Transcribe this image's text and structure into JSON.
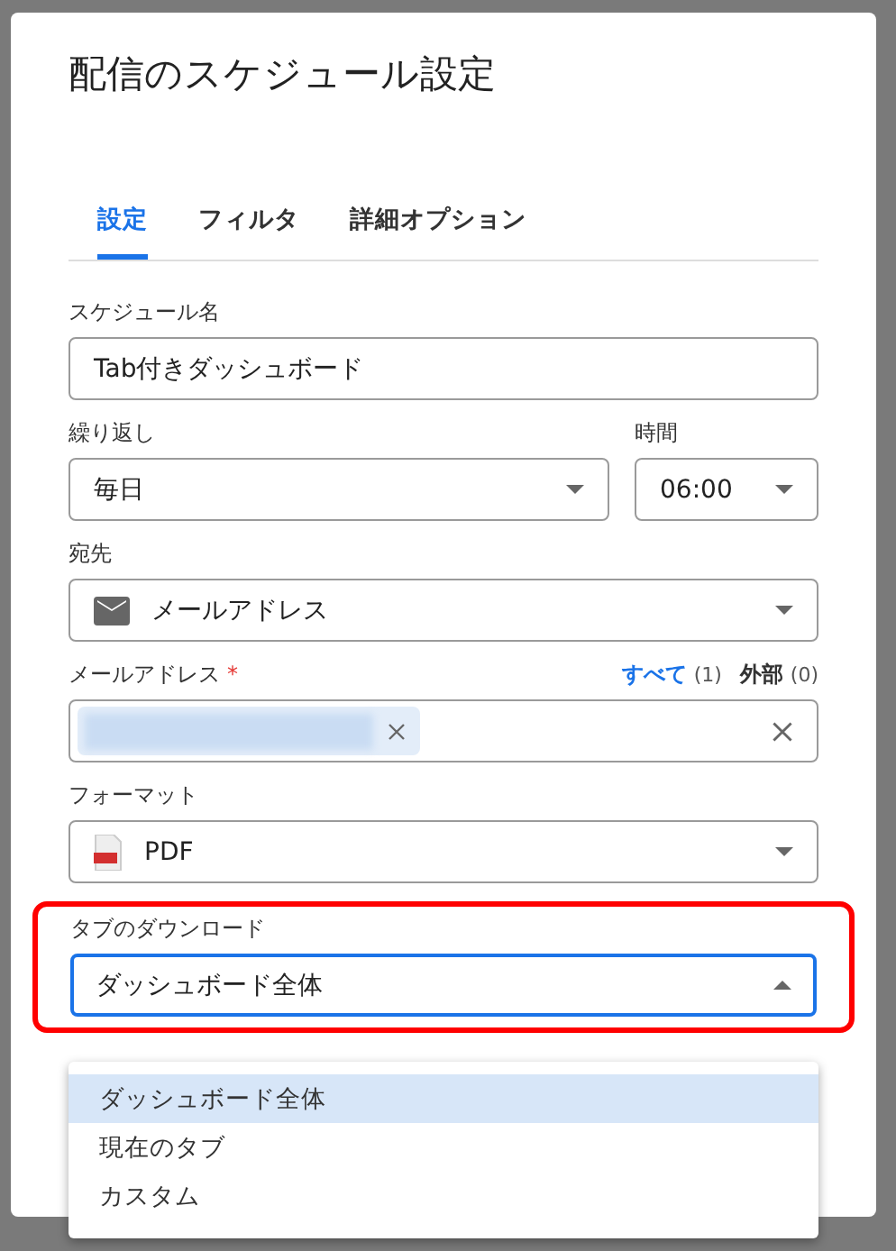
{
  "dialog": {
    "title": "配信のスケジュール設定"
  },
  "tabs": [
    {
      "label": "設定",
      "selected": true
    },
    {
      "label": "フィルタ",
      "selected": false
    },
    {
      "label": "詳細オプション",
      "selected": false
    }
  ],
  "schedule_name": {
    "label": "スケジュール名",
    "value": "Tab付きダッシュボード"
  },
  "repeat": {
    "label": "繰り返し",
    "value": "毎日"
  },
  "time": {
    "label": "時間",
    "value": "06:00"
  },
  "destination": {
    "label": "宛先",
    "value": "メールアドレス"
  },
  "email": {
    "label": "メールアドレス",
    "required_mark": "*",
    "all_link": "すべて",
    "all_count": "(1)",
    "external_label": "外部",
    "external_count": "(0)"
  },
  "format": {
    "label": "フォーマット",
    "value": "PDF"
  },
  "tab_download": {
    "label": "タブのダウンロード",
    "value": "ダッシュボード全体",
    "expanded": true,
    "highlighted": true,
    "options": [
      {
        "label": "ダッシュボード全体",
        "selected": true
      },
      {
        "label": "現在のタブ",
        "selected": false
      },
      {
        "label": "カスタム",
        "selected": false
      }
    ]
  }
}
